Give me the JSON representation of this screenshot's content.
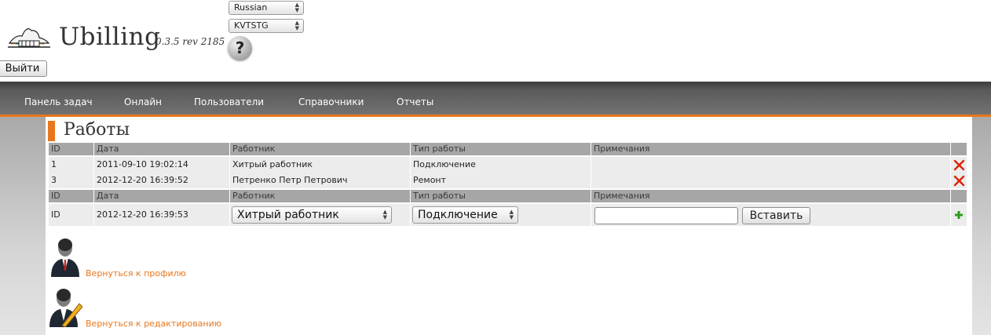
{
  "header": {
    "logo_name": "Ubilling",
    "version": "0.3.5 rev 2185",
    "language_select": "Russian",
    "skin_select": "KVTSTG",
    "help_label": "?",
    "logout_label": "Выйти"
  },
  "nav": {
    "items": [
      "Панель задач",
      "Онлайн",
      "Пользователи",
      "Справочники",
      "Отчеты"
    ]
  },
  "page": {
    "title": "Работы"
  },
  "table": {
    "headers": [
      "ID",
      "Дата",
      "Работник",
      "Тип работы",
      "Примечания"
    ],
    "rows": [
      {
        "id": "1",
        "date": "2011-09-10 19:02:14",
        "worker": "Хитрый работник",
        "type": "Подключение",
        "note": ""
      },
      {
        "id": "3",
        "date": "2012-12-20 16:39:52",
        "worker": "Петренко Петр Петрович",
        "type": "Ремонт",
        "note": ""
      }
    ]
  },
  "form": {
    "id_label": "ID",
    "date": "2012-12-20 16:39:53",
    "worker_select": "Хитрый работник",
    "type_select": "Подключение",
    "note_value": "",
    "insert_label": "Вставить"
  },
  "links": {
    "back_profile": "Вернуться к профилю",
    "back_edit": "Вернуться к редактированию"
  },
  "colors": {
    "accent": "#e9761c",
    "delete": "#dd2200",
    "add": "#2f9a1f"
  },
  "icons": {
    "logo": "logo-icon",
    "help": "help-icon",
    "delete": "delete-icon",
    "add": "add-icon",
    "profile": "user-profile-icon",
    "edit": "user-edit-icon"
  }
}
